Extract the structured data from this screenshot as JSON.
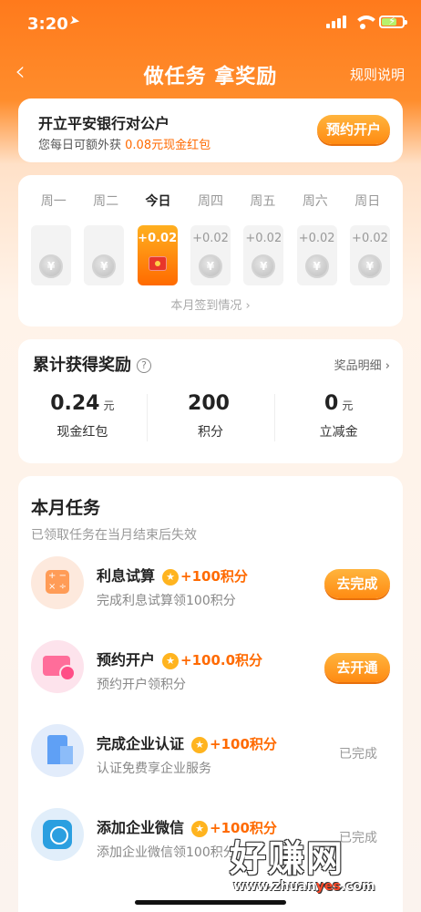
{
  "status": {
    "time": "3:20"
  },
  "nav": {
    "title": "做任务 拿奖励",
    "rules": "规则说明"
  },
  "open_account": {
    "title": "开立平安银行对公户",
    "desc_prefix": "您每日可额外获",
    "desc_highlight": "0.08元现金红包",
    "button": "预约开户"
  },
  "week": {
    "days": [
      "周一",
      "周二",
      "今日",
      "周四",
      "周五",
      "周六",
      "周日"
    ],
    "cells": [
      {
        "amount": ""
      },
      {
        "amount": ""
      },
      {
        "amount": "+0.02"
      },
      {
        "amount": "+0.02"
      },
      {
        "amount": "+0.02"
      },
      {
        "amount": "+0.02"
      },
      {
        "amount": "+0.02"
      }
    ],
    "coin_symbol": "¥",
    "link": "本月签到情况 ›"
  },
  "rewards": {
    "title": "累计获得奖励",
    "help": "?",
    "link": "奖品明细 ›",
    "items": [
      {
        "value": "0.24",
        "unit": "元",
        "name": "现金红包"
      },
      {
        "value": "200",
        "unit": "",
        "name": "积分"
      },
      {
        "value": "0",
        "unit": "元",
        "name": "立减金"
      }
    ]
  },
  "tasks": {
    "title": "本月任务",
    "subtitle": "已领取任务在当月结束后失效",
    "items": [
      {
        "name": "利息试算",
        "points": "+100积分",
        "desc": "完成利息试算领100积分",
        "action": "去完成",
        "status": ""
      },
      {
        "name": "预约开户",
        "points": "+100.0积分",
        "desc": "预约开户领积分",
        "action": "去开通",
        "status": ""
      },
      {
        "name": "完成企业认证",
        "points": "+100积分",
        "desc": "认证免费享企业服务",
        "action": "",
        "status": "已完成"
      },
      {
        "name": "添加企业微信",
        "points": "+100积分",
        "desc": "添加企业微信领100积分",
        "action": "",
        "status": "已完成"
      }
    ],
    "badge_symbol": "★"
  },
  "watermark": {
    "text": "好赚网",
    "url_a": "www.zhuan",
    "url_b": "yes",
    "url_c": ".com"
  }
}
